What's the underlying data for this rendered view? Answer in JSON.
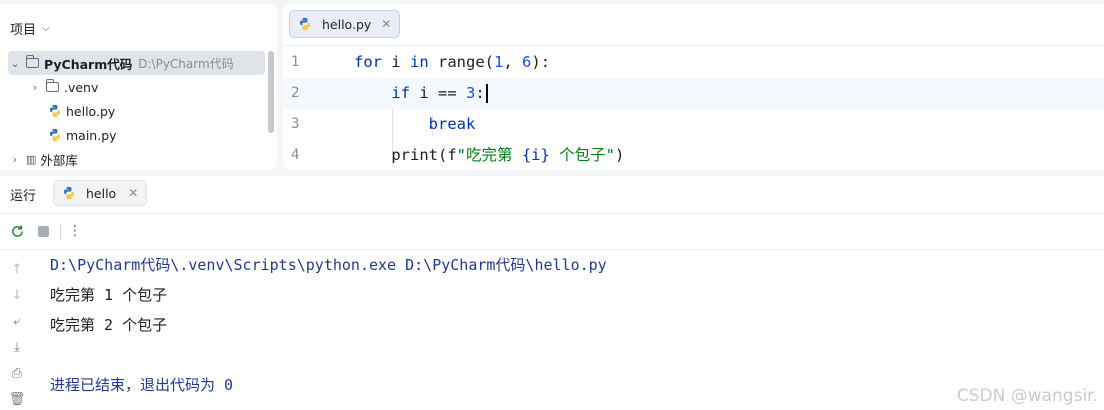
{
  "project": {
    "header": "项目",
    "tree": [
      {
        "label": "PyCharm代码",
        "hint": "D:\\PyCharm代码"
      },
      {
        "label": ".venv"
      },
      {
        "label": "hello.py"
      },
      {
        "label": "main.py"
      },
      {
        "label": "外部库"
      }
    ]
  },
  "editor": {
    "tab_label": "hello.py",
    "lines": [
      {
        "n": "1",
        "indent": "",
        "tokens": [
          {
            "t": "for",
            "c": "kw"
          },
          {
            "t": " i "
          },
          {
            "t": "in",
            "c": "kw"
          },
          {
            "t": " range("
          },
          {
            "t": "1",
            "c": "num"
          },
          {
            "t": ", "
          },
          {
            "t": "6",
            "c": "num"
          },
          {
            "t": "):"
          }
        ]
      },
      {
        "n": "2",
        "indent": "    ",
        "tokens": [
          {
            "t": "if",
            "c": "kw"
          },
          {
            "t": " i == "
          },
          {
            "t": "3",
            "c": "num"
          },
          {
            "t": ":"
          }
        ]
      },
      {
        "n": "3",
        "indent": "        ",
        "tokens": [
          {
            "t": "break",
            "c": "kw"
          }
        ]
      },
      {
        "n": "4",
        "indent": "    ",
        "tokens": [
          {
            "t": "print(f"
          },
          {
            "t": "\"吃完第 ",
            "c": "str"
          },
          {
            "t": "{i}",
            "c": "kw"
          },
          {
            "t": " 个包子\"",
            "c": "str"
          },
          {
            "t": ")"
          }
        ]
      }
    ]
  },
  "run": {
    "header": "运行",
    "tab_label": "hello",
    "console": [
      "D:\\PyCharm代码\\.venv\\Scripts\\python.exe D:\\PyCharm代码\\hello.py",
      "吃完第 1 个包子",
      "吃完第 2 个包子",
      "",
      "进程已结束，退出代码为 0"
    ]
  },
  "watermark": "CSDN @wangsir.",
  "colors": {
    "keyword": "#0033b3",
    "number": "#1750eb",
    "string": "#067d17"
  }
}
